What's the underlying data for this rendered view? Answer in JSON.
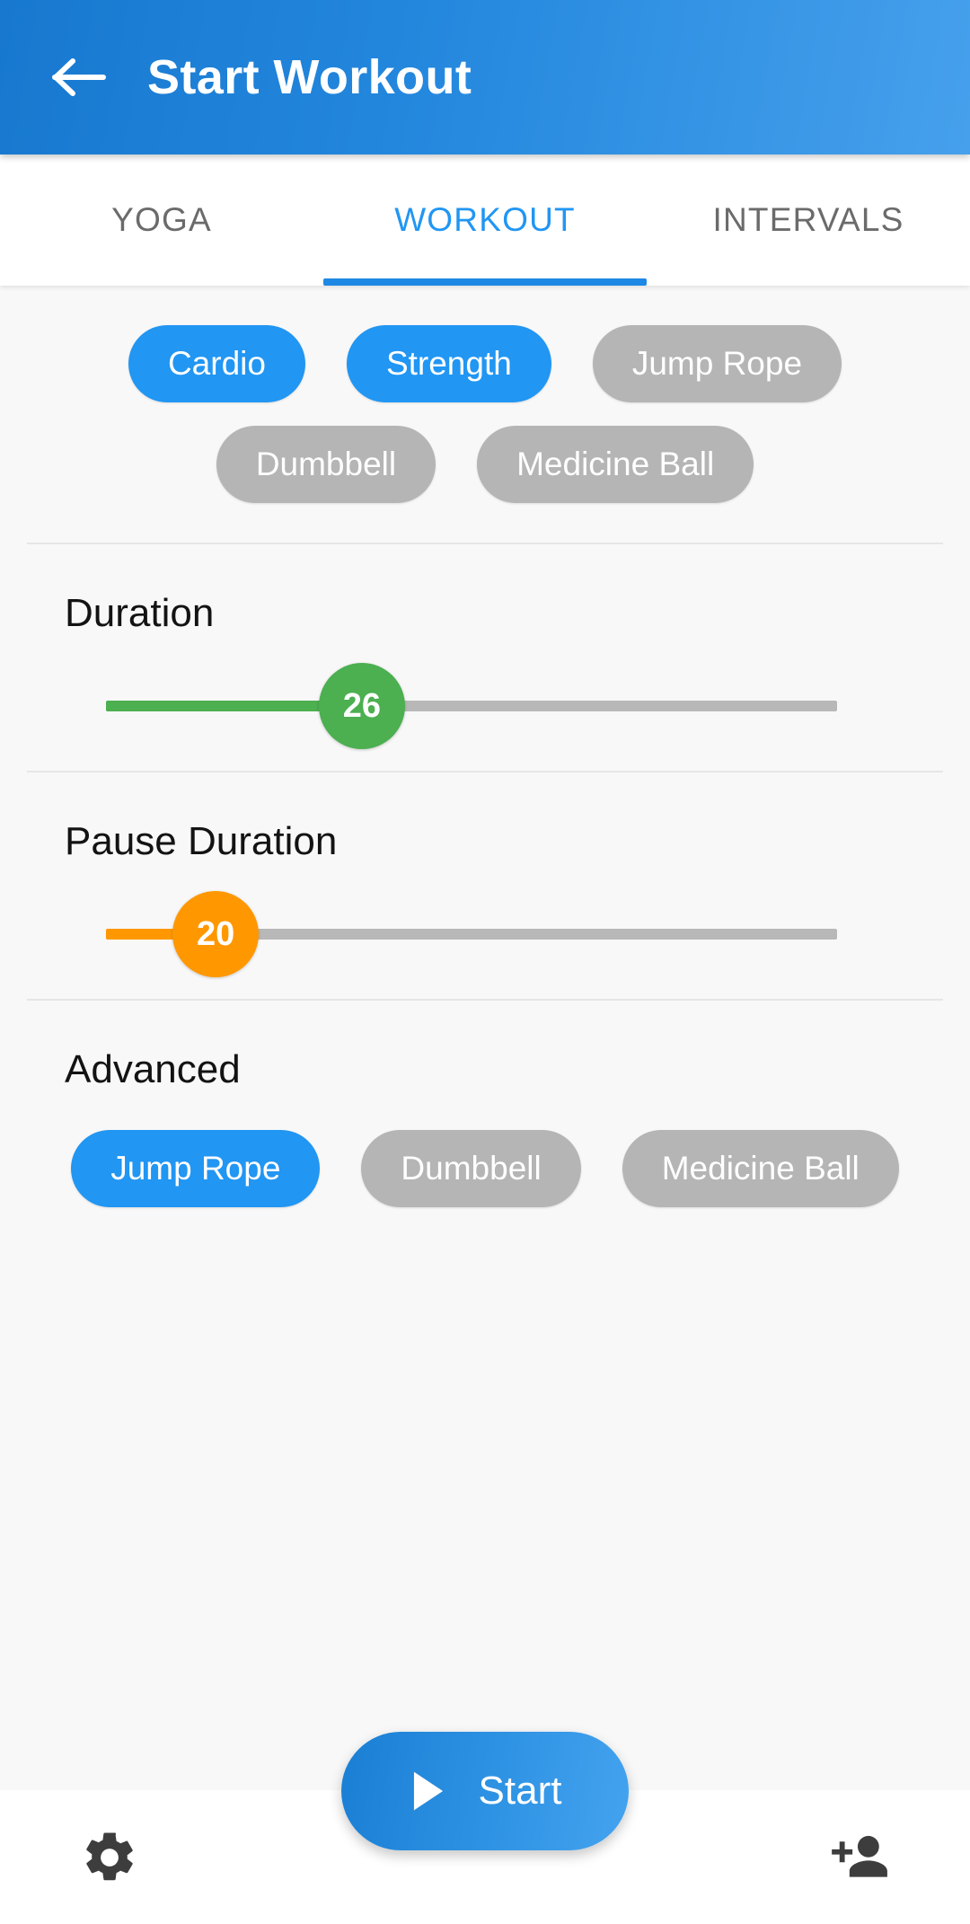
{
  "appbar": {
    "back_icon": "arrow-left-icon",
    "title": "Start Workout"
  },
  "tabs": [
    {
      "label": "YOGA",
      "active": false
    },
    {
      "label": "WORKOUT",
      "active": true
    },
    {
      "label": "INTERVALS",
      "active": false
    }
  ],
  "filters": {
    "row1": [
      {
        "label": "Cardio",
        "selected": true
      },
      {
        "label": "Strength",
        "selected": true
      },
      {
        "label": "Jump Rope",
        "selected": false
      }
    ],
    "row2": [
      {
        "label": "Dumbbell",
        "selected": false
      },
      {
        "label": "Medicine Ball",
        "selected": false
      }
    ]
  },
  "duration": {
    "title": "Duration",
    "value": "26",
    "percent": 35,
    "color": "#4caf50"
  },
  "pause_duration": {
    "title": "Pause Duration",
    "value": "20",
    "percent": 15,
    "color": "#ff9800"
  },
  "advanced": {
    "title": "Advanced",
    "chips": [
      {
        "label": "Jump Rope",
        "selected": true
      },
      {
        "label": "Dumbbell",
        "selected": false
      },
      {
        "label": "Medicine Ball",
        "selected": false
      }
    ]
  },
  "fab": {
    "play_icon": "play-icon",
    "label": "Start"
  },
  "bottombar": {
    "left_icon": "gear-icon",
    "right_icon": "add-person-icon"
  },
  "colors": {
    "accent": "#2196f3",
    "chip_off": "#b5b5b5",
    "duration": "#4caf50",
    "pause": "#ff9800",
    "background": "#f8f8f8"
  }
}
